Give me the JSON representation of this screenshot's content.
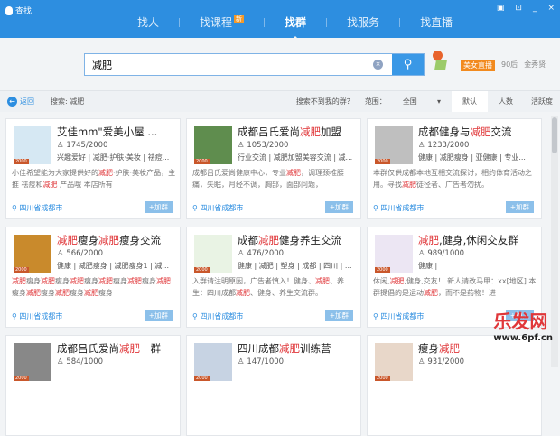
{
  "app": {
    "title": "查找",
    "controls": [
      "▣",
      "⊡",
      "_",
      "×"
    ]
  },
  "nav": {
    "tabs": [
      {
        "label": "找人"
      },
      {
        "label": "找课程",
        "badge": "新"
      },
      {
        "label": "找群",
        "active": true
      },
      {
        "label": "找服务"
      },
      {
        "label": "找直播"
      }
    ]
  },
  "search": {
    "value": "减肥",
    "placeholder": "",
    "clear": "×",
    "button_icon": "search-icon"
  },
  "promo": {
    "live": "美女直播",
    "t1": "90后",
    "t2": "金秀贤"
  },
  "toolbar": {
    "back": "返回",
    "query": "搜索: 减肥",
    "notfound": "搜索不到我的群？",
    "range_label": "范围：",
    "range_value": "全国",
    "sort": [
      "默认",
      "人数",
      "活跃度"
    ],
    "sort_active": "默认"
  },
  "cards": [
    {
      "title": "艾佳mm\"爱美小屋 ...",
      "count": "1745/2000",
      "tags": "兴趣爱好 | 减肥·护肤·美妆 | 祛痘...",
      "desc": "小佳希望能为大家提供好的减肥·护肤·美妆产品，主推 祛痘和减肥 产品哦 本店所有",
      "loc": "四川省成都市",
      "join": "+加群",
      "avatar": "#d6e8f3"
    },
    {
      "title": "成都吕氏爱尚减肥加盟",
      "count": "1053/2000",
      "tags": "行业交流 | 减肥加盟美容交流 | 减...",
      "desc": "成都吕氏爱尚健康中心，专业减肥，调理颈椎腰痛，失眠，月经不调，胸部，面部问题，",
      "loc": "四川省成都市",
      "join": "+加群",
      "avatar": "#5f8d4e"
    },
    {
      "title": "成都健身与减肥交流",
      "count": "1233/2000",
      "tags": "健康 | 减肥瘦身 | 亚健康 | 专业...",
      "desc": "本群仅供成都本地互相交流探讨，相约体育活动之用。寻找减肥徒径者、广告者勿扰。",
      "loc": "四川省成都市",
      "join": "+加群",
      "avatar": "#bfbfbf"
    },
    {
      "title": "减肥瘦身减肥瘦身交流",
      "count": "566/2000",
      "tags": "健康 | 减肥瘦身 | 减肥瘦身1 | 减...",
      "desc": "减肥瘦身减肥瘦身减肥瘦身减肥瘦身减肥瘦身减肥瘦身减肥瘦身减肥瘦身减肥瘦身",
      "loc": "四川省成都市",
      "join": "+加群",
      "avatar": "#c98a2c"
    },
    {
      "title": "成都减肥健身养生交流",
      "count": "476/2000",
      "tags": "健康 | 减肥 | 塑身 | 成都 | 四川 | ...",
      "desc": "入群请注明原因，广告者慎入！健身、减肥、养生：四川成都减肥、健身、养生交流群。",
      "loc": "四川省成都市",
      "join": "+加群",
      "avatar": "#e9f3e4"
    },
    {
      "title": "减肥,健身,休闲交友群",
      "count": "989/1000",
      "tags": "健康 |",
      "desc": "休闲,减肥,健身,交友！ 新人请改马甲：xx[地区] 本群提倡的是运动减肥，而不是药物！进",
      "loc": "四川省成都市",
      "join": "+加入",
      "avatar": "#ece6f3"
    },
    {
      "title": "成都吕氏爱尚减肥一群",
      "count": "584/1000",
      "tags": "",
      "desc": "",
      "loc": "",
      "join": "",
      "avatar": "#888888"
    },
    {
      "title": "四川成都减肥训练营",
      "count": "147/1000",
      "tags": "",
      "desc": "",
      "loc": "",
      "join": "",
      "avatar": "#c7d3e3"
    },
    {
      "title": "瘦身减肥",
      "count": "931/2000",
      "tags": "",
      "desc": "",
      "loc": "",
      "join": "",
      "avatar": "#e8d7c9"
    }
  ],
  "watermark": {
    "cn": "乐发网",
    "url": "www.6pf.cn"
  },
  "colors": {
    "primary": "#2d8ee0",
    "highlight": "#e0373a",
    "badge": "#f28a1e"
  }
}
